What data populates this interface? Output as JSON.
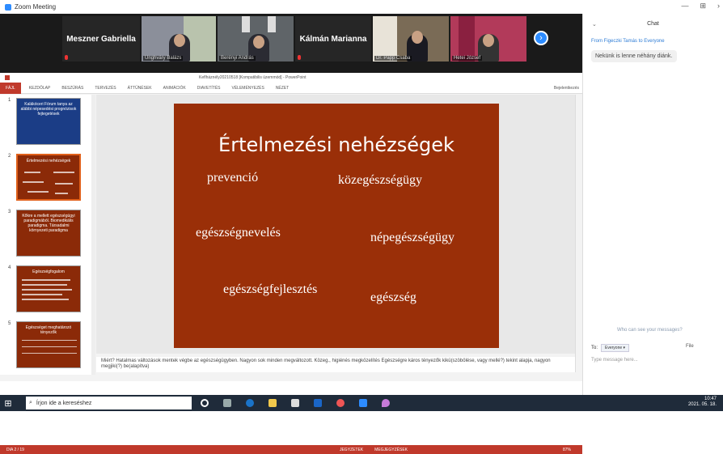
{
  "window": {
    "title": "Zoom Meeting",
    "controls": [
      "—",
      "⊞",
      "›"
    ]
  },
  "gallery": {
    "tiles": [
      {
        "type": "name",
        "text": "Meszner Gabriella"
      },
      {
        "type": "video",
        "label": "Unghváry Balázs"
      },
      {
        "type": "video",
        "label": "Berényi András"
      },
      {
        "type": "name",
        "text": "Kálmán Marianna"
      },
      {
        "type": "video",
        "label": "Dr. Papp Csaba"
      },
      {
        "type": "video",
        "label": "Hetei József"
      }
    ]
  },
  "powerpoint": {
    "filename": "Keflháznély20210518 [Kompatibilis üzemmód] - PowerPoint",
    "tabs": [
      "FÁJL",
      "KEZDŐLAP",
      "BESZÚRÁS",
      "TERVEZÉS",
      "ÁTTŰNÉSEK",
      "ANIMÁCIÓK",
      "DIAVETÍTÉS",
      "VÉLEMÉNYEZÉS",
      "NÉZET"
    ],
    "signin": "Bejelentkezés",
    "thumbnails": [
      {
        "num": "1",
        "title": "Kalákóceri Fórum tanya az alábbi népesedési prognózisok fejtegetések"
      },
      {
        "num": "2",
        "title": "Értelmezési nehézségek"
      },
      {
        "num": "3",
        "title": "Kőkre a mellett egészségügyi paradigmából. Biomedikális paradigma. Társadalmi környezeti paradigma"
      },
      {
        "num": "4",
        "title": "Egészségfogalom"
      },
      {
        "num": "5",
        "title": "Egészséget meghatározó tényezők"
      }
    ],
    "slide": {
      "title": "Értelmezési nehézségek",
      "words": [
        "prevenció",
        "közegészségügy",
        "egészségnevelés",
        "népegészségügy",
        "egészségfejlesztés",
        "egészség"
      ]
    },
    "notes": "Miért? Hatalmas változások mentek végbe az egészségügyben. Nagyon sok minden megváltozott. Közeg., higiénés megközelítés Egészségre káros tényezők kikü(szöbölése, vagy mellé?) tekint alapja, nagyon megjiki(?) be(alapítva)",
    "status": {
      "slide": "DIA 2 / 19",
      "notes_btn": "JEGYZETEK",
      "comments_btn": "MEGJEGYZÉSEK",
      "zoom": "87%"
    }
  },
  "chat": {
    "title": "Chat",
    "from": "From Figeczki Tamás to Everyone",
    "message": "Nekünk is lenne néhány diánk.",
    "who_can_see": "Who can see your messages?",
    "to_label": "To:",
    "to_value": "Everyone ▾",
    "file": "File",
    "input_placeholder": "Type message here..."
  },
  "taskbar": {
    "search_placeholder": "Írjon ide a kereséshez",
    "time": "10:47",
    "date": "2021. 05. 18."
  }
}
